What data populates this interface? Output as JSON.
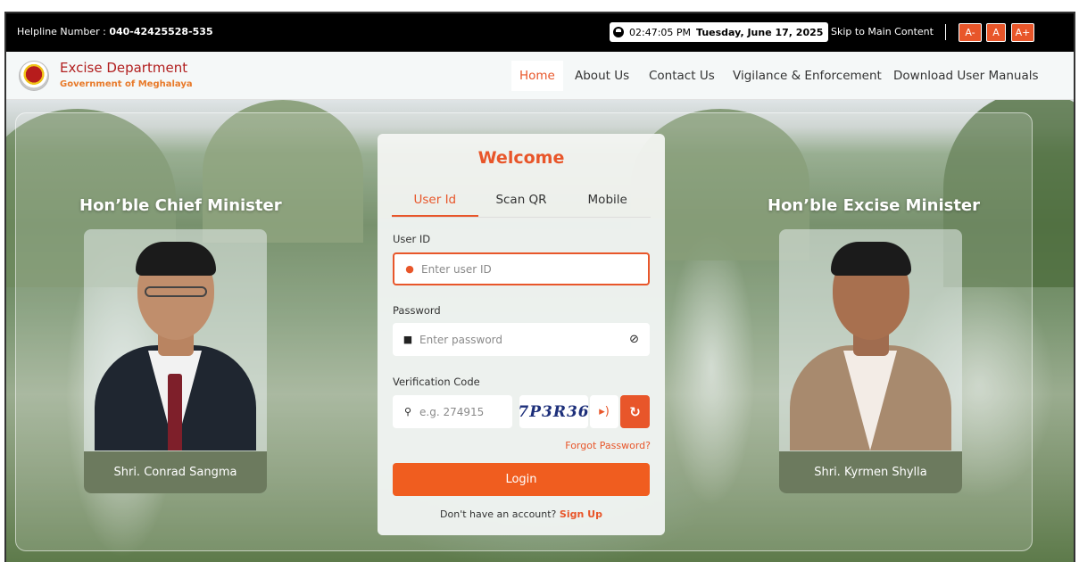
{
  "topbar": {
    "helpline_label": "Helpline Number : ",
    "helpline_number": "040-42425528-535",
    "time": "02:47:05 PM",
    "date": "Tuesday, June 17, 2025",
    "skip_label": "Skip to Main Content",
    "font_small": "A-",
    "font_normal": "A",
    "font_large": "A+"
  },
  "header": {
    "dept_name": "Excise Department",
    "dept_sub": "Government of Meghalaya",
    "nav": [
      "Home",
      "About Us",
      "Contact Us",
      "Vigilance & Enforcement",
      "Download User Manuals"
    ],
    "active_nav": "Home"
  },
  "ministers": {
    "left": {
      "title": "Hon’ble Chief Minister",
      "name": "Shri. Conrad Sangma"
    },
    "right": {
      "title": "Hon’ble Excise Minister",
      "name": "Shri. Kyrmen Shylla"
    }
  },
  "login": {
    "title": "Welcome",
    "tabs": [
      "User Id",
      "Scan QR",
      "Mobile"
    ],
    "active_tab": "User Id",
    "user_label": "User ID",
    "user_placeholder": "Enter user ID",
    "password_label": "Password",
    "password_placeholder": "Enter password",
    "verification_label": "Verification Code",
    "verification_placeholder": "e.g. 274915",
    "captcha_text": "7P3R36",
    "forgot_label": "Forgot Password?",
    "login_label": "Login",
    "no_account_text": "Don't have an account?",
    "signup_label": "Sign Up"
  },
  "colors": {
    "accent": "#e8562a",
    "topbar": "#000000",
    "dept_name": "#b21f1f",
    "name_bar": "#6c7a5e"
  },
  "icons": [
    "clock-icon",
    "emblem-logo",
    "user-icon",
    "lock-icon",
    "eye-slash-icon",
    "key-icon",
    "speaker-icon",
    "refresh-icon"
  ]
}
